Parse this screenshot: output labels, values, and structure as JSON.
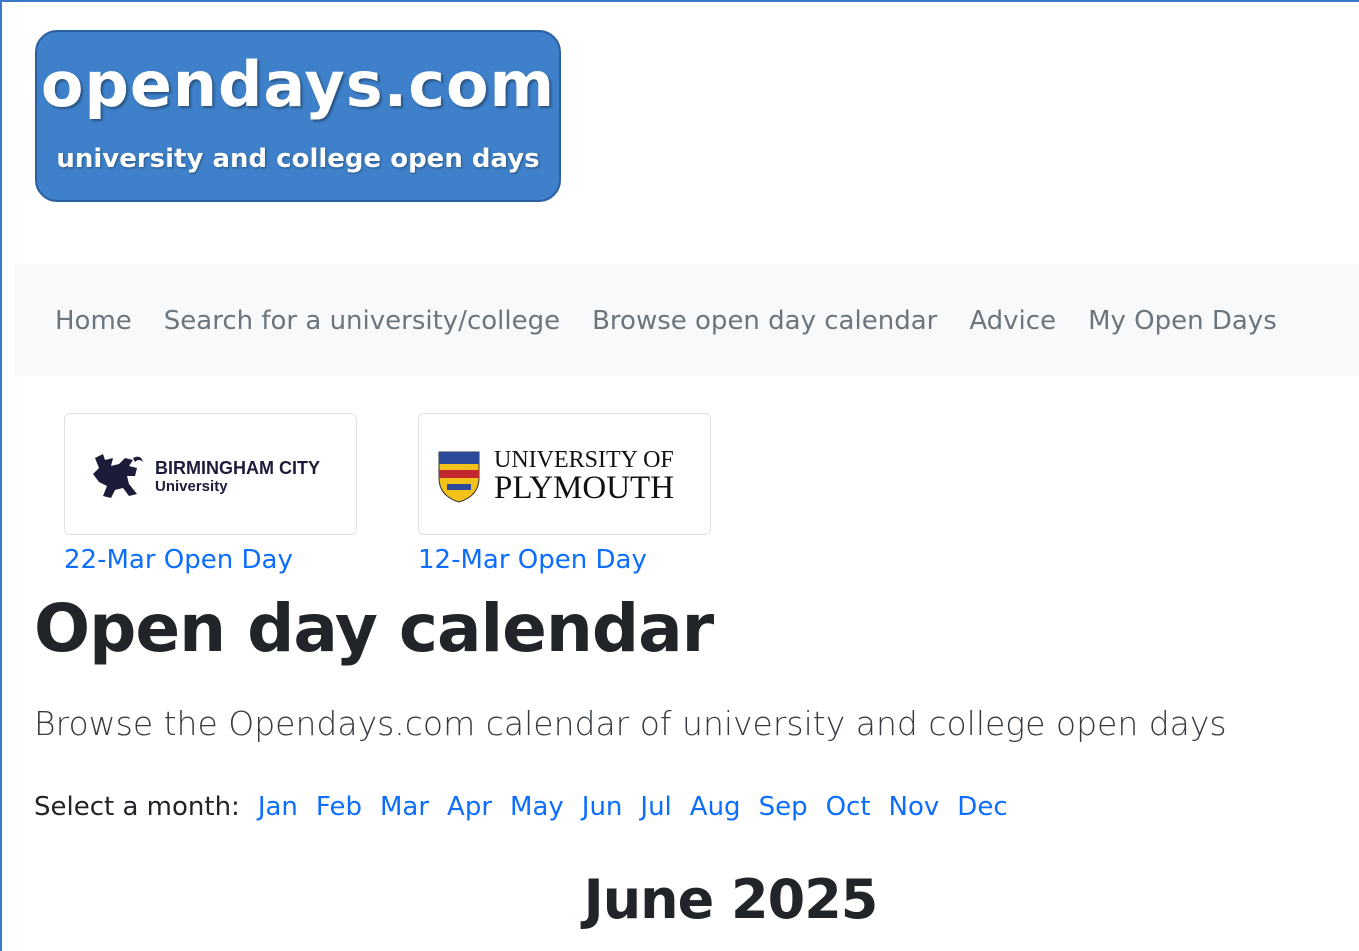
{
  "logo": {
    "brand": "opendays.com",
    "tagline": "university and college open days"
  },
  "nav": {
    "items": [
      "Home",
      "Search for a university/college",
      "Browse open day calendar",
      "Advice",
      "My Open Days"
    ]
  },
  "featured": [
    {
      "name_line1": "BIRMINGHAM CITY",
      "name_line2": "University",
      "link": "22-Mar Open Day"
    },
    {
      "name_line1": "UNIVERSITY OF",
      "name_line2": "PLYMOUTH",
      "link": "12-Mar Open Day"
    }
  ],
  "page": {
    "title": "Open day calendar",
    "lead": "Browse the Opendays.com calendar of university and college open days",
    "month_label": "Select a month:",
    "months": [
      "Jan",
      "Feb",
      "Mar",
      "Apr",
      "May",
      "Jun",
      "Jul",
      "Aug",
      "Sep",
      "Oct",
      "Nov",
      "Dec"
    ],
    "current_month": "June 2025"
  },
  "colors": {
    "logo_bg": "#3e80c9",
    "link": "#0d6efd",
    "nav_text": "#6c757d",
    "nav_bg": "#f8f9fa"
  }
}
